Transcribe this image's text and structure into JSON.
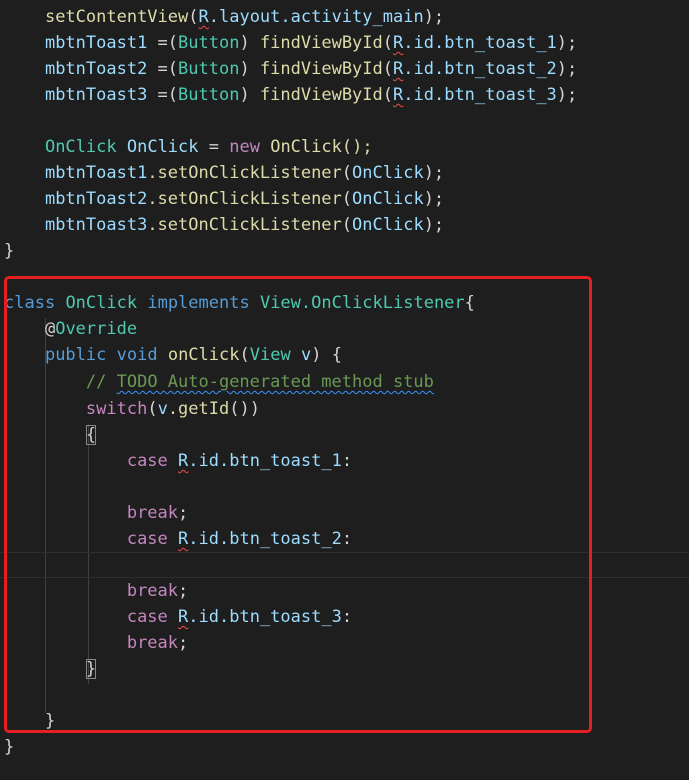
{
  "editor": {
    "code": {
      "setcontent": "setContentView",
      "r": "R",
      "layout_main": ".layout.activity_main",
      "m1": "mbtnToast1",
      "m2": "mbtnToast2",
      "m3": "mbtnToast3",
      "assign": " =(",
      "button": "Button",
      "paren_close_space": ") ",
      "find": "findViewById",
      "id1": ".id.btn_toast_1",
      "id2": ".id.btn_toast_2",
      "id3": ".id.btn_toast_3",
      "onclick": "OnClick",
      "new_kw": "new",
      "setlistener": ".setOnClickListener",
      "close_brace": "}",
      "class_kw": "class",
      "implements_kw": "implements",
      "view_listener": "View.OnClickListener",
      "at": "@",
      "override": "Override",
      "public_kw": "public",
      "void_kw": "void",
      "onclick_method": "onClick",
      "view": "View",
      "v": "v",
      "comment_slashes": "// ",
      "comment_body": "TODO Auto-generated method stub",
      "switch_kw": "switch",
      "getid": ".getId",
      "case_kw": "case",
      "break_kw": "break",
      "id_text": ".id.",
      "btn1": "btn_toast_1",
      "btn2": "btn_toast_2",
      "btn3": "btn_toast_3",
      "colon": ":",
      "semi": ";",
      "open_brace": "{",
      "open_paren": "(",
      "close_paren": ")",
      "close_paren_semi": ");",
      "open_brace_plain": "{",
      "new_onclick_call": "OnClick();",
      "eq": " = "
    }
  },
  "colors": {
    "background": "#1e1e1e",
    "highlight_border": "#e51f1f",
    "keyword": "#569cd6",
    "control_keyword": "#c586c0",
    "function": "#dcdcaa",
    "variable": "#9cdcfe",
    "type": "#4ec9b0",
    "comment": "#6a9955"
  }
}
